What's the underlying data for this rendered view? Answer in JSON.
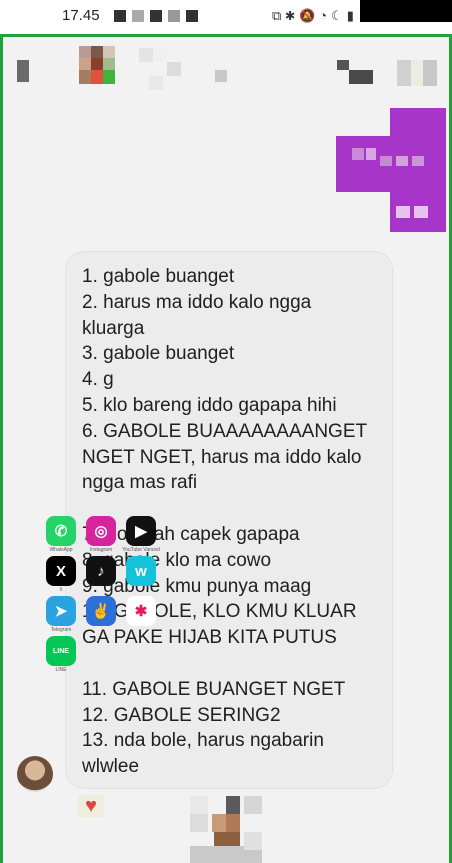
{
  "status_bar": {
    "time": "17.45",
    "icons": [
      "cast-icon",
      "bluetooth-icon",
      "mute-icon",
      "wifi-icon",
      "dnd-icon",
      "signal-icon"
    ]
  },
  "message": {
    "lines": [
      "1. gabole buanget",
      "2. harus ma iddo kalo ngga\nkluarga",
      "3. gabole buanget",
      "4. g",
      "5. klo bareng iddo gapapa hihi",
      "6. GABOLE BUAAAAAAAANGET\nNGET NGET, harus ma iddo kalo\nngga mas rafi",
      "",
      "7. klo udah capek gapapa",
      "8. gabole klo ma cowo",
      "9. gabole kmu punya maag",
      "10. GABOLE, KLO KMU KLUAR\nGA PAKE HIJAB KITA PUTUS",
      "",
      "11. GABOLE BUANGET NGET",
      "12. GABOLE SERING2",
      "13. nda bole, harus ngabarin\nwlwlee"
    ]
  },
  "floating_apps": [
    {
      "icon": "whatsapp-icon",
      "label": "WhatsApp",
      "color": "#25d366"
    },
    {
      "icon": "instagram-icon",
      "label": "Instagram",
      "color": "#d6249f"
    },
    {
      "icon": "youtube-icon",
      "label": "YouTube Vanced",
      "color": "#111111"
    },
    {
      "icon": "x-icon",
      "label": "X",
      "color": "#000000"
    },
    {
      "icon": "tiktok-icon",
      "label": "",
      "color": "#111111"
    },
    {
      "icon": "w-icon",
      "label": "",
      "color": "#14c2d9"
    },
    {
      "icon": "telegram-icon",
      "label": "Telegram",
      "color": "#2aa3e0"
    },
    {
      "icon": "peace-icon",
      "label": "",
      "color": "#2d6fd8"
    },
    {
      "icon": "slack-icon",
      "label": "",
      "color": "#ffffff"
    },
    {
      "icon": "line-icon",
      "label": "LINE",
      "color": "#06c755"
    }
  ],
  "colors": {
    "frame": "#1fa33a",
    "bubble": "#ececec",
    "sent_bubble": "#a735c9"
  }
}
